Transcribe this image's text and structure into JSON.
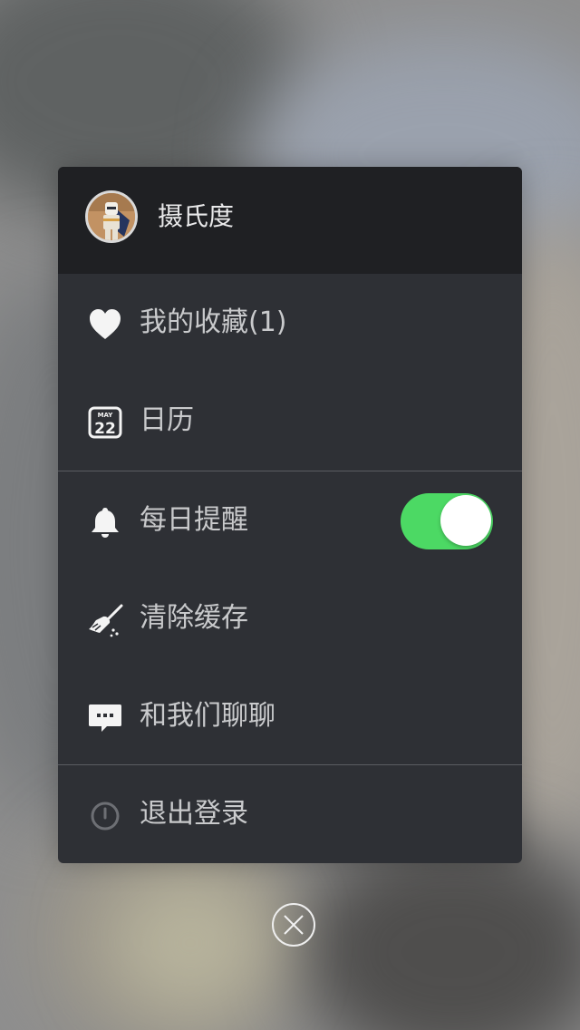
{
  "profile": {
    "name": "摄氏度",
    "avatar": "lego-trooper-avatar"
  },
  "menu": {
    "favorites": {
      "label": "我的收藏(1)",
      "icon": "heart-icon"
    },
    "calendar": {
      "label": "日历",
      "icon": "calendar-icon",
      "month": "MAY",
      "day": "22"
    },
    "reminder": {
      "label": "每日提醒",
      "icon": "bell-icon",
      "enabled": true
    },
    "clear_cache": {
      "label": "清除缓存",
      "icon": "broom-icon"
    },
    "chat": {
      "label": "和我们聊聊",
      "icon": "chat-bubble-icon"
    },
    "logout": {
      "label": "退出登录",
      "icon": "power-icon"
    }
  },
  "colors": {
    "panel": "#2e3035",
    "header": "#1f2023",
    "toggle_on": "#4cd964",
    "text": "#c9cacc"
  },
  "close": {
    "icon": "close-icon"
  }
}
